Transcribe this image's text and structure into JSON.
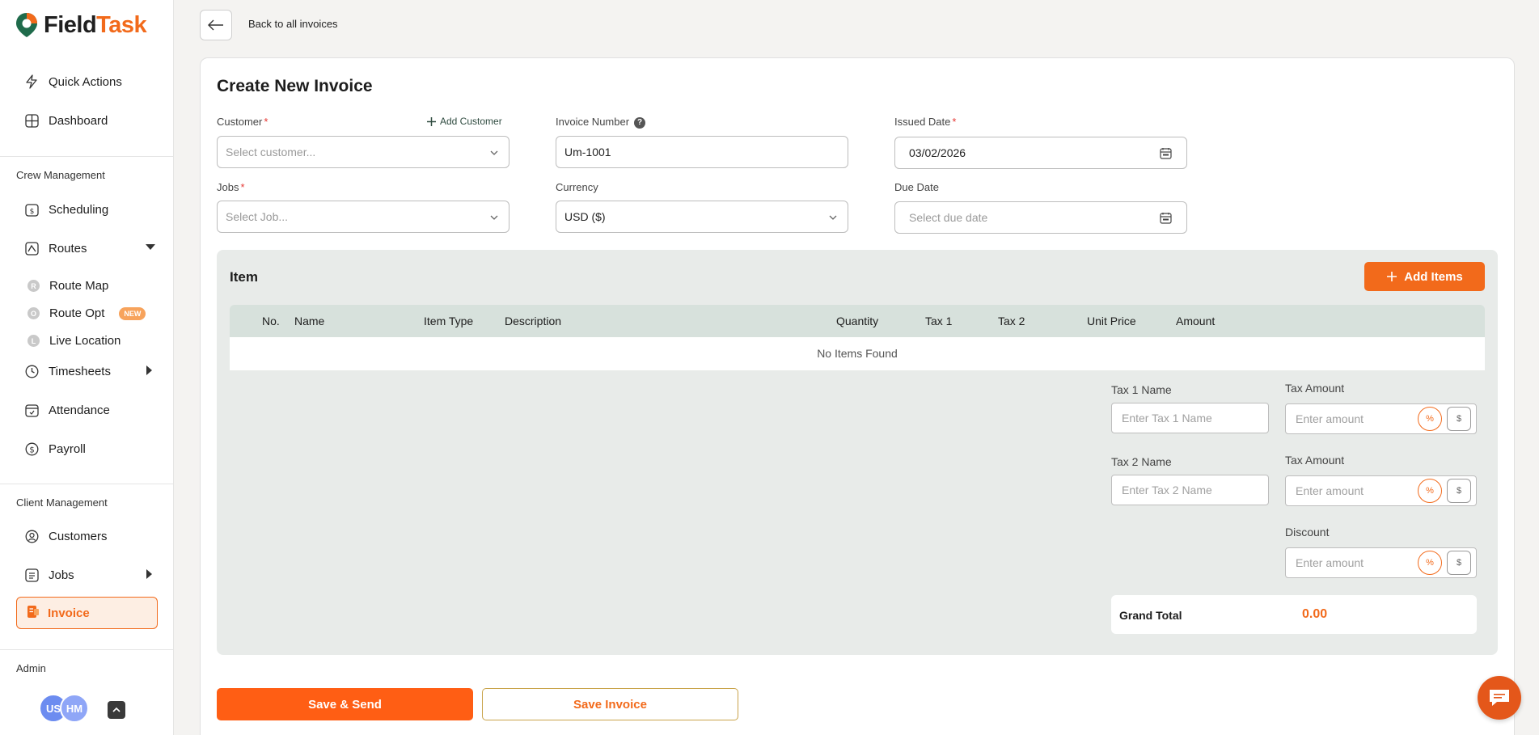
{
  "brand": {
    "name_part1": "Field",
    "name_part2": "Task",
    "accent": "#f26a1b"
  },
  "sidebar": {
    "quick_actions": "Quick Actions",
    "dashboard": "Dashboard",
    "crew_section": "Crew Management",
    "scheduling": "Scheduling",
    "routes": "Routes",
    "route_map": "Route Map",
    "route_opt": "Route Opt",
    "new_badge": "NEW",
    "live_location": "Live Location",
    "timesheets": "Timesheets",
    "attendance": "Attendance",
    "payroll": "Payroll",
    "client_section": "Client Management",
    "customers": "Customers",
    "jobs": "Jobs",
    "invoice": "Invoice",
    "admin_section": "Admin",
    "avatar1": "US",
    "avatar2": "HM"
  },
  "header": {
    "back_text": "Back to all invoices"
  },
  "form": {
    "title": "Create New Invoice",
    "customer_label": "Customer",
    "add_customer": "Add Customer",
    "customer_placeholder": "Select customer...",
    "invoice_number_label": "Invoice Number",
    "invoice_number_value": "Um-1001",
    "issued_date_label": "Issued Date",
    "issued_date_value": "03/02/2026",
    "jobs_label": "Jobs",
    "jobs_placeholder": "Select Job...",
    "currency_label": "Currency",
    "currency_value": "USD ($)",
    "due_date_label": "Due Date",
    "due_date_placeholder": "Select due date"
  },
  "items": {
    "title": "Item",
    "add_button": "Add Items",
    "columns": [
      "No.",
      "Name",
      "Item Type",
      "Description",
      "Quantity",
      "Tax 1",
      "Tax 2",
      "Unit Price",
      "Amount"
    ],
    "empty_text": "No Items Found"
  },
  "totals": {
    "tax1_name_label": "Tax 1 Name",
    "tax1_name_placeholder": "Enter Tax 1 Name",
    "tax_amount_label": "Tax Amount",
    "amount_placeholder": "Enter amount",
    "tax2_name_label": "Tax 2 Name",
    "tax2_name_placeholder": "Enter Tax 2 Name",
    "discount_label": "Discount",
    "percent_symbol": "%",
    "dollar_symbol": "$",
    "grand_total_label": "Grand Total",
    "grand_total_value": "0.00"
  },
  "actions": {
    "save_send": "Save & Send",
    "save_invoice": "Save Invoice"
  }
}
